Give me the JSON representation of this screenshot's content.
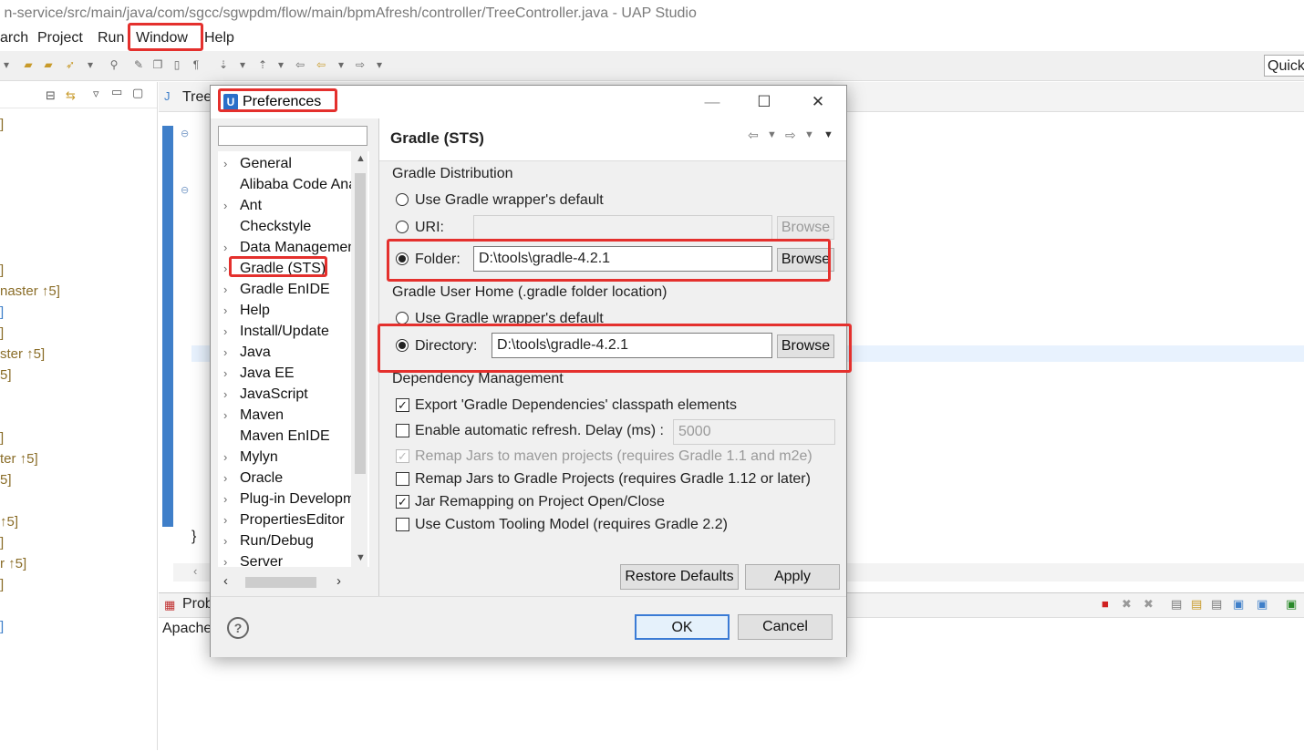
{
  "window": {
    "title": "n-service/src/main/java/com/sgcc/sgwpdm/flow/main/bpmAfresh/controller/TreeController.java - UAP Studio"
  },
  "menubar": {
    "items": [
      "arch",
      "Project",
      "Run",
      "Window",
      "Help"
    ]
  },
  "toolbar": {
    "quick_access": "Quick"
  },
  "left_pane": {
    "project_markers": [
      "]",
      "]",
      "naster ↑5]",
      "]",
      "]",
      "ster ↑5]",
      "5]",
      "]",
      "ter ↑5]",
      "5]",
      "↑5]",
      "]",
      "r ↑5]",
      "]",
      "]"
    ]
  },
  "editor": {
    "tab_label": "Tree",
    "closing_brace": "}"
  },
  "bottom_pane": {
    "tab_label": "Prob",
    "content": "Apache"
  },
  "dialog": {
    "title": "Preferences",
    "app_icon": "U",
    "minimize": "—",
    "maximize": "☐",
    "close": "✕",
    "filter_placeholder": "",
    "nav_items": [
      {
        "label": "General",
        "expandable": true
      },
      {
        "label": "Alibaba Code Analysis",
        "expandable": false
      },
      {
        "label": "Ant",
        "expandable": true
      },
      {
        "label": "Checkstyle",
        "expandable": false
      },
      {
        "label": "Data Management",
        "expandable": true
      },
      {
        "label": "Gradle (STS)",
        "expandable": true,
        "selected": true
      },
      {
        "label": "Gradle EnIDE",
        "expandable": true
      },
      {
        "label": "Help",
        "expandable": true
      },
      {
        "label": "Install/Update",
        "expandable": true
      },
      {
        "label": "Java",
        "expandable": true
      },
      {
        "label": "Java EE",
        "expandable": true
      },
      {
        "label": "JavaScript",
        "expandable": true
      },
      {
        "label": "Maven",
        "expandable": true
      },
      {
        "label": "Maven EnIDE",
        "expandable": false
      },
      {
        "label": "Mylyn",
        "expandable": true
      },
      {
        "label": "Oracle",
        "expandable": true
      },
      {
        "label": "Plug-in Development",
        "expandable": true
      },
      {
        "label": "PropertiesEditor",
        "expandable": true
      },
      {
        "label": "Run/Debug",
        "expandable": true
      },
      {
        "label": "Server",
        "expandable": true
      }
    ],
    "page": {
      "title": "Gradle (STS)",
      "distribution": {
        "heading": "Gradle Distribution",
        "wrapper_default": "Use Gradle wrapper's default",
        "uri_label": "URI:",
        "uri_value": "",
        "folder_label": "Folder:",
        "folder_value": "D:\\tools\\gradle-4.2.1",
        "browse": "Browse",
        "selected": "folder"
      },
      "user_home": {
        "heading": "Gradle User Home (.gradle folder location)",
        "wrapper_default": "Use Gradle wrapper's default",
        "directory_label": "Directory:",
        "directory_value": "D:\\tools\\gradle-4.2.1",
        "browse": "Browse",
        "selected": "directory"
      },
      "dependency": {
        "heading": "Dependency Management",
        "options": [
          {
            "label": "Export 'Gradle Dependencies' classpath elements",
            "checked": true,
            "enabled": true
          },
          {
            "label": "Enable automatic refresh. Delay (ms) :",
            "checked": false,
            "enabled": true
          },
          {
            "label": "Remap Jars to maven projects (requires Gradle 1.1 and m2e)",
            "checked": true,
            "enabled": false
          },
          {
            "label": "Remap Jars to Gradle Projects (requires Gradle 1.12 or later)",
            "checked": false,
            "enabled": true
          },
          {
            "label": "Jar Remapping on Project Open/Close",
            "checked": true,
            "enabled": true
          },
          {
            "label": "Use Custom Tooling Model (requires Gradle 2.2)",
            "checked": false,
            "enabled": true
          }
        ],
        "delay_value": "5000"
      },
      "restore_defaults": "Restore Defaults",
      "apply": "Apply"
    },
    "help": "?",
    "ok": "OK",
    "cancel": "Cancel"
  },
  "colors": {
    "highlight": "#e4302d",
    "accent": "#2a6fc9",
    "project_marker": "#8a6d28"
  }
}
